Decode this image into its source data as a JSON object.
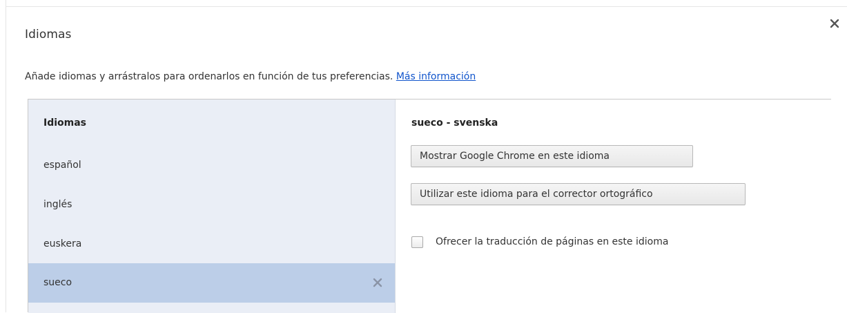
{
  "dialog": {
    "title": "Idiomas",
    "intro_text": "Añade idiomas y arrástralos para ordenarlos en función de tus preferencias.",
    "intro_link": "Más información"
  },
  "language_list": {
    "header": "Idiomas",
    "items": [
      {
        "label": "español",
        "selected": false
      },
      {
        "label": "inglés",
        "selected": false
      },
      {
        "label": "euskera",
        "selected": false
      },
      {
        "label": "sueco",
        "selected": true
      }
    ]
  },
  "details": {
    "title": "sueco - svenska",
    "display_button": "Mostrar Google Chrome en este idioma",
    "spellcheck_button": "Utilizar este idioma para el corrector ortográfico",
    "translate_checkbox_label": "Ofrecer la traducción de páginas en este idioma",
    "translate_checked": false
  },
  "icons": {
    "dialog_close": "close-icon",
    "row_remove": "remove-icon"
  },
  "colors": {
    "list_background": "#eaeef6",
    "selected_row": "#bccee8",
    "link": "#1155cc"
  }
}
